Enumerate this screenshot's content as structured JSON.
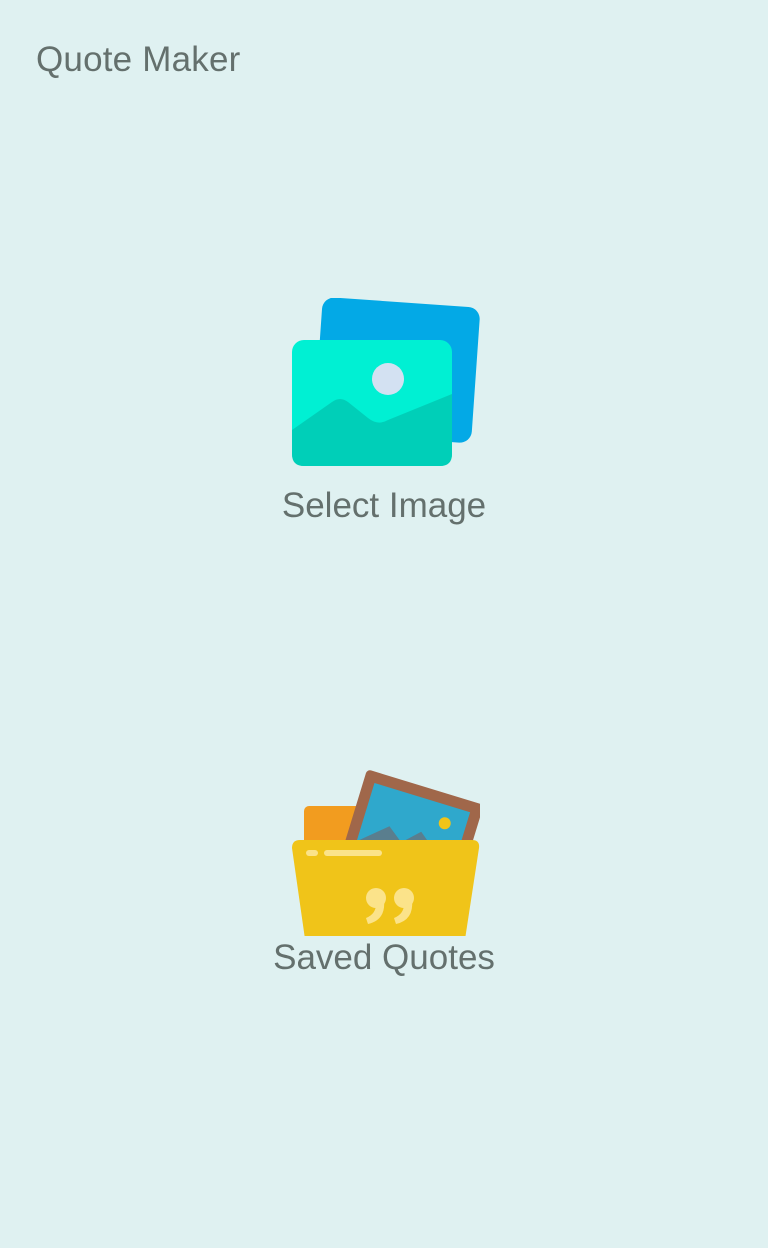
{
  "app": {
    "title": "Quote Maker"
  },
  "menu": {
    "select_image": {
      "label": "Select Image",
      "icon": "image-gallery-icon"
    },
    "saved_quotes": {
      "label": "Saved Quotes",
      "icon": "quote-folder-icon"
    }
  },
  "colors": {
    "background": "#dff1f1",
    "text": "#64706d",
    "gallery_back": "#03a9e6",
    "gallery_front": "#00f0d3",
    "gallery_hill": "#00cfb8",
    "gallery_sun": "#d3e1f2",
    "folder_yellow": "#f0c419",
    "folder_orange": "#f29c1f",
    "frame_brown": "#a0674a",
    "frame_blue": "#2fa8cc"
  }
}
